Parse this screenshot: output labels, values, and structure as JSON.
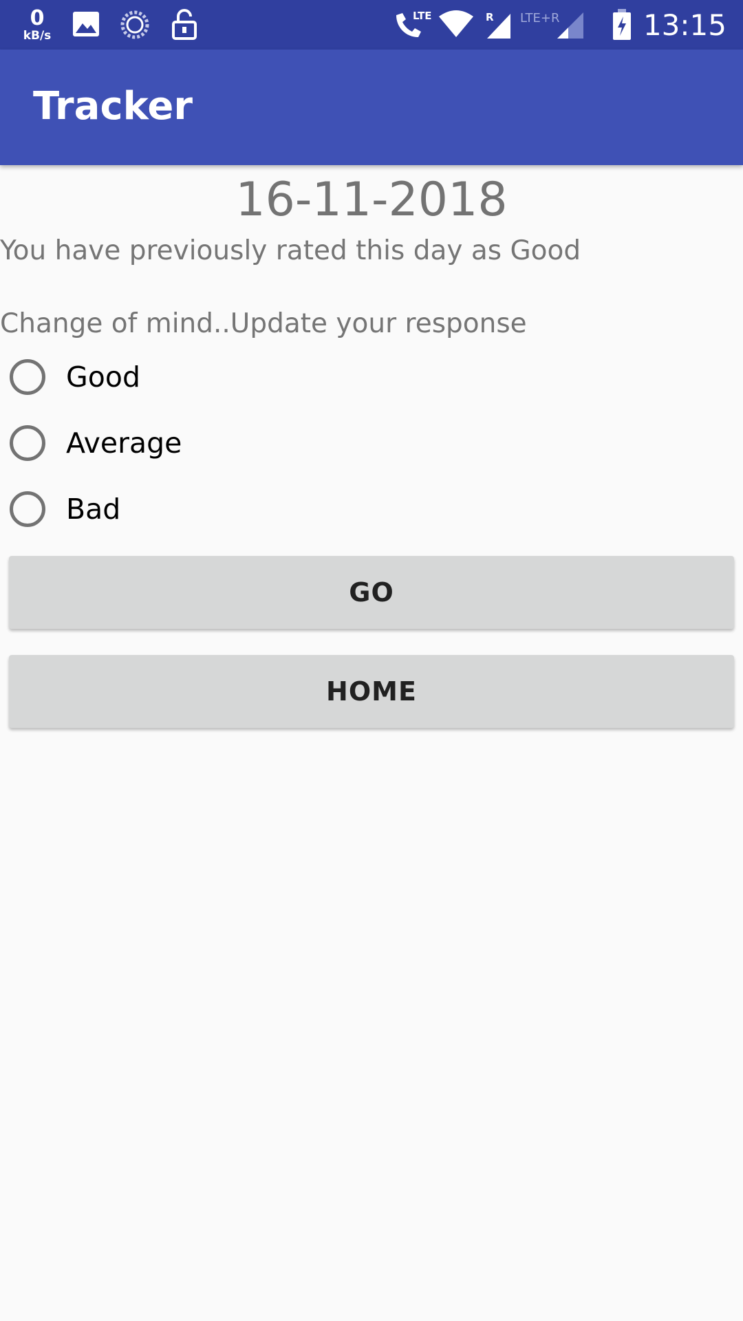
{
  "status_bar": {
    "net_speed_value": "0",
    "net_speed_unit": "kB/s",
    "clock": "13:15",
    "lte_label": "LTE",
    "roaming_label": "R",
    "lte2_label": "LTE+R",
    "icons": [
      "image-icon",
      "sync-icon",
      "unlock-icon",
      "volte-phone-icon",
      "wifi-icon",
      "signal-icon",
      "signal-icon",
      "battery-charging-icon"
    ],
    "background_color": "#303f9f"
  },
  "app_bar": {
    "title": "Tracker",
    "background_color": "#3f51b5"
  },
  "content": {
    "date": "16-11-2018",
    "previous_rating_text": "You have previously rated this day as Good",
    "update_prompt": "Change of mind..Update your response",
    "options": [
      {
        "label": "Good",
        "selected": false
      },
      {
        "label": "Average",
        "selected": false
      },
      {
        "label": "Bad",
        "selected": false
      }
    ],
    "go_button": "GO",
    "home_button": "HOME"
  }
}
